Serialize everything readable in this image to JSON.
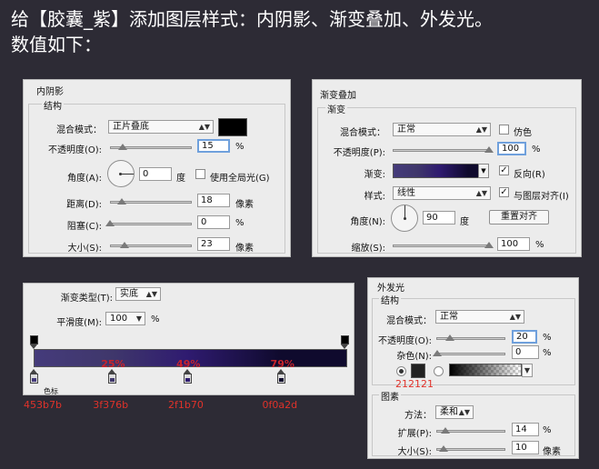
{
  "heading": {
    "line1": "给【胶囊_紫】添加图层样式：内阴影、渐变叠加、外发光。",
    "line2": "数值如下："
  },
  "inner_shadow": {
    "title": "内阴影",
    "group": "结构",
    "blend_label": "混合模式：",
    "blend_value": "正片叠底",
    "color": "#000000",
    "opacity_label": "不透明度(O):",
    "opacity_value": "15",
    "opacity_unit": "%",
    "opacity_level": 15,
    "angle_label": "角度(A):",
    "angle_value": "0",
    "angle_unit": "度",
    "global_light_label": "使用全局光(G)",
    "global_light_checked": false,
    "distance_label": "距离(D):",
    "distance_value": "18",
    "distance_unit": "像素",
    "choke_label": "阻塞(C):",
    "choke_value": "0",
    "choke_unit": "%",
    "size_label": "大小(S):",
    "size_value": "23",
    "size_unit": "像素"
  },
  "gradient_overlay": {
    "title": "渐变叠加",
    "group": "渐变",
    "blend_label": "混合模式：",
    "blend_value": "正常",
    "dither_label": "仿色",
    "dither_checked": false,
    "opacity_label": "不透明度(P):",
    "opacity_value": "100",
    "opacity_unit": "%",
    "opacity_level": 100,
    "gradient_label": "渐变:",
    "reverse_label": "反向(R)",
    "reverse_checked": true,
    "style_label": "样式:",
    "style_value": "线性",
    "align_label": "与图层对齐(I)",
    "align_checked": true,
    "angle_label": "角度(N):",
    "angle_value": "90",
    "angle_unit": "度",
    "reset_label": "重置对齐",
    "scale_label": "缩放(S):",
    "scale_value": "100",
    "scale_unit": "%",
    "scale_level": 100
  },
  "gradient_editor": {
    "type_label": "渐变类型(T):",
    "type_value": "实底",
    "smooth_label": "平滑度(M):",
    "smooth_value": "100",
    "smooth_unit": "%",
    "stops": [
      {
        "pct_label": "",
        "location": 0,
        "color": "#453b7b",
        "hex_label": "453b7b"
      },
      {
        "pct_label": "25%",
        "location": 25,
        "color": "#3f376b",
        "hex_label": "3f376b"
      },
      {
        "pct_label": "49%",
        "location": 49,
        "color": "#2f1b70",
        "hex_label": "2f1b70"
      },
      {
        "pct_label": "79%",
        "location": 79,
        "color": "#0f0a2d",
        "hex_label": "0f0a2d"
      }
    ],
    "partial_label": "色标"
  },
  "outer_glow": {
    "title": "外发光",
    "group_structure": "结构",
    "blend_label": "混合模式：",
    "blend_value": "正常",
    "opacity_label": "不透明度(O):",
    "opacity_value": "20",
    "opacity_unit": "%",
    "opacity_level": 20,
    "noise_label": "杂色(N):",
    "noise_value": "0",
    "noise_unit": "%",
    "color": "#212121",
    "color_label": "212121",
    "group_elements": "图素",
    "technique_label": "方法：",
    "technique_value": "柔和",
    "spread_label": "扩展(P):",
    "spread_value": "14",
    "spread_unit": "%",
    "size_label": "大小(S):",
    "size_value": "10",
    "size_unit": "像素"
  }
}
